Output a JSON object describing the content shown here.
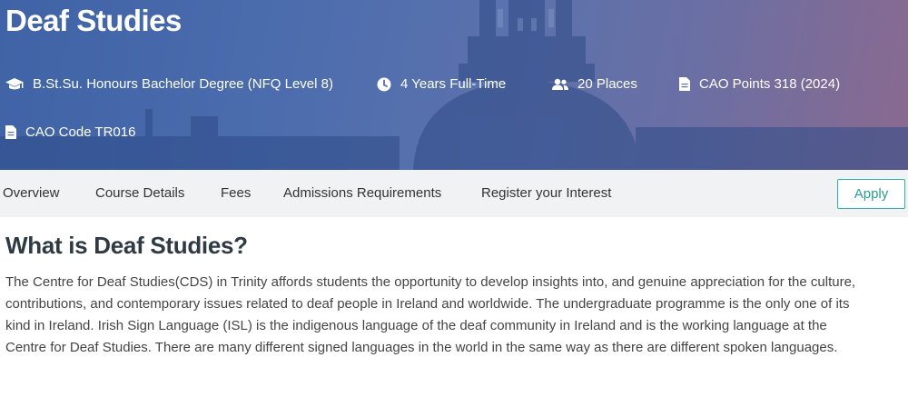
{
  "hero": {
    "title": "Deaf Studies",
    "facts": [
      {
        "icon": "graduation-cap-icon",
        "text": "B.St.Su. Honours Bachelor Degree (NFQ Level 8)"
      },
      {
        "icon": "clock-icon",
        "text": "4 Years Full-Time"
      },
      {
        "icon": "users-icon",
        "text": "20 Places"
      },
      {
        "icon": "document-icon",
        "text": "CAO Points 318 (2024)"
      },
      {
        "icon": "document-icon",
        "text": "CAO Code TR016"
      }
    ]
  },
  "nav": {
    "items": [
      "Overview",
      "Course Details",
      "Fees",
      "Admissions Requirements",
      "Register your Interest"
    ],
    "apply_label": "Apply"
  },
  "main": {
    "heading": "What is Deaf Studies?",
    "paragraph": "The Centre for Deaf Studies(CDS) in Trinity affords students the opportunity to develop insights into, and genuine appreciation for the culture, contributions, and contemporary issues related to deaf people in Ireland and worldwide. The undergraduate programme is the only one of its kind in Ireland. Irish Sign Language (ISL) is the indigenous language of the deaf community in Ireland and is the working language at the Centre for Deaf Studies. There are many different signed languages in the world in the same way as there are different spoken languages."
  },
  "colors": {
    "accent": "#2db3a8",
    "hero_start": "#3f63a6",
    "hero_end": "#8a6a8f",
    "nav_bg": "#f1f2f3"
  }
}
